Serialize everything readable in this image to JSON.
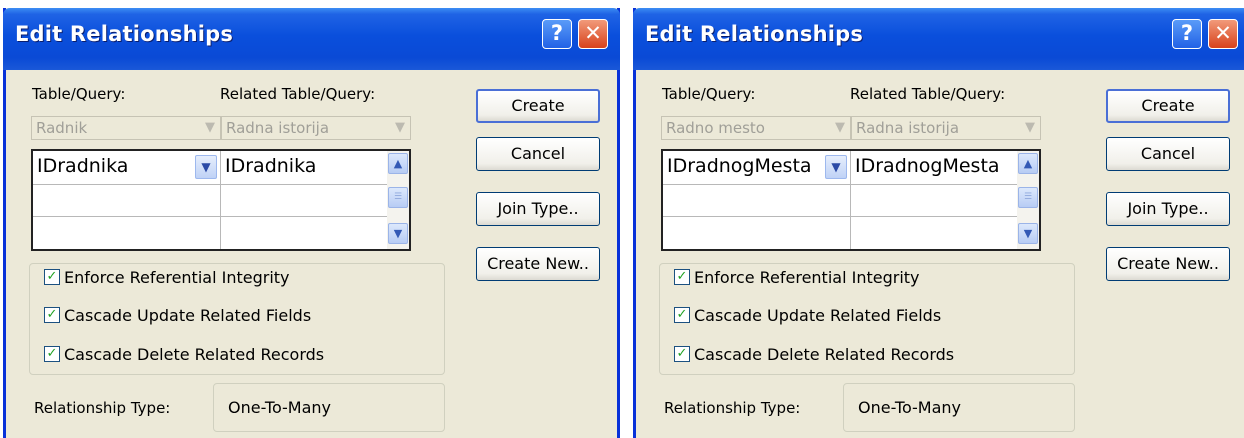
{
  "dialogs": [
    {
      "title": "Edit Relationships",
      "table_query_label": "Table/Query:",
      "related_table_query_label": "Related Table/Query:",
      "table": "Radnik",
      "related_table": "Radna istorija",
      "field": "IDradnika",
      "related_field": "IDradnika",
      "enforce_ri": "Enforce Referential Integrity",
      "cascade_update": "Cascade Update Related Fields",
      "cascade_delete": "Cascade Delete Related Records",
      "relationship_type_label": "Relationship Type:",
      "relationship_type": "One-To-Many",
      "buttons": {
        "create": "Create",
        "cancel": "Cancel",
        "join_type": "Join Type..",
        "create_new": "Create New.."
      },
      "icons": {
        "help": "?",
        "close": "✕",
        "check": "✓"
      }
    },
    {
      "title": "Edit Relationships",
      "table_query_label": "Table/Query:",
      "related_table_query_label": "Related Table/Query:",
      "table": "Radno mesto",
      "related_table": "Radna istorija",
      "field": "IDradnogMesta",
      "related_field": "IDradnogMesta",
      "enforce_ri": "Enforce Referential Integrity",
      "cascade_update": "Cascade Update Related Fields",
      "cascade_delete": "Cascade Delete Related Records",
      "relationship_type_label": "Relationship Type:",
      "relationship_type": "One-To-Many",
      "buttons": {
        "create": "Create",
        "cancel": "Cancel",
        "join_type": "Join Type..",
        "create_new": "Create New.."
      },
      "icons": {
        "help": "?",
        "close": "✕",
        "check": "✓"
      }
    }
  ],
  "colors": {
    "title_bar": "#0a4fdc",
    "dialog_bg": "#ece9d8",
    "close_button": "#d8421c",
    "check_mark": "#21a121"
  }
}
